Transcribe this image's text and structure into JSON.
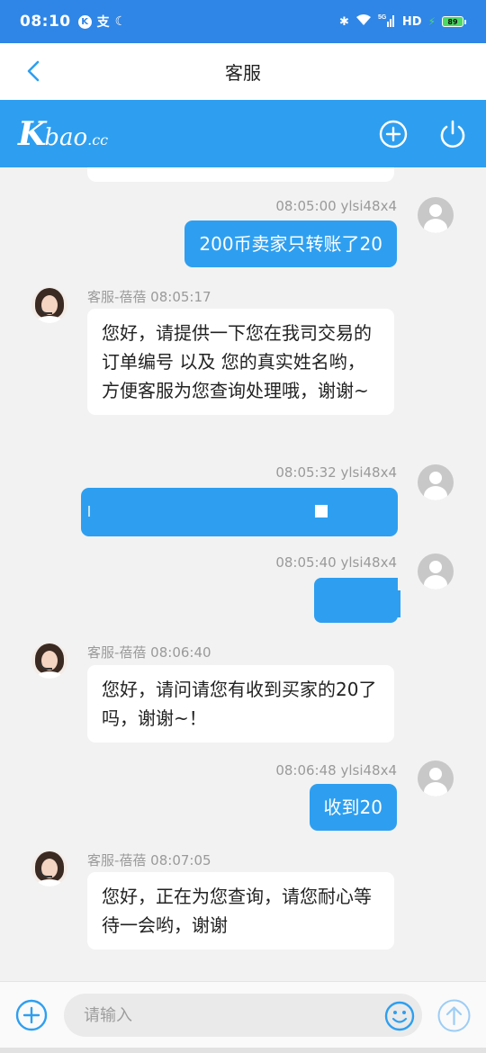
{
  "status_bar": {
    "time": "08:10",
    "k_badge": "K",
    "pay_icon": "pay-icon",
    "moon_icon": "moon-icon",
    "network": "5G",
    "hd": "HD",
    "battery": "89"
  },
  "header": {
    "title": "客服",
    "back_icon": "chevron-left-icon"
  },
  "brand": {
    "logo_k": "K",
    "logo_bao": "bao",
    "logo_cc": ".cc",
    "add_icon": "plus-circle-icon",
    "power_icon": "power-icon"
  },
  "messages": [
    {
      "direction": "out",
      "meta": "08:05:00 ylsi48x4",
      "text": "200币卖家只转账了20"
    },
    {
      "direction": "in",
      "meta": "客服-蓓蓓 08:05:17",
      "text": "您好，请提供一下您在我司交易的订单编号 以及 您的真实姓名哟，方便客服为您查询处理哦，谢谢~"
    },
    {
      "direction": "out",
      "meta": "08:05:32 ylsi48x4",
      "text": "",
      "redacted": true
    },
    {
      "direction": "out",
      "meta": "08:05:40 ylsi48x4",
      "text": "",
      "redacted": true
    },
    {
      "direction": "in",
      "meta": "客服-蓓蓓 08:06:40",
      "text": "您好，请问请您有收到买家的20了吗，谢谢~！"
    },
    {
      "direction": "out",
      "meta": "08:06:48 ylsi48x4",
      "text": "收到20"
    },
    {
      "direction": "in",
      "meta": "客服-蓓蓓 08:07:05",
      "text": "您好，正在为您查询，请您耐心等待一会哟，谢谢"
    }
  ],
  "input": {
    "placeholder": "请输入",
    "value": "",
    "add_icon": "plus-circle-icon",
    "emoji_icon": "emoji-icon",
    "send_icon": "send-arrow-icon"
  },
  "colors": {
    "accent": "#2e9ff0",
    "status_bar": "#2f86e6",
    "background": "#f2f2f2"
  }
}
